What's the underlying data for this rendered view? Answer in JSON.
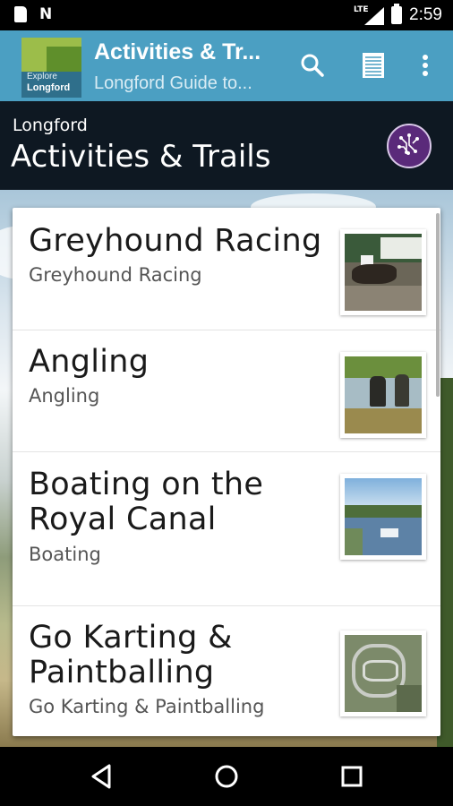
{
  "status_bar": {
    "network_label": "LTE",
    "time": "2:59",
    "icons": [
      "sd-card-icon",
      "n-notification-icon",
      "signal-icon",
      "battery-icon"
    ]
  },
  "app_bar": {
    "logo_line1": "Explore",
    "logo_line2": "Longford",
    "title": "Activities & Tr...",
    "subtitle": "Longford Guide to...",
    "icons": [
      "search-icon",
      "list-view-icon",
      "more-vert-icon"
    ],
    "background_color": "#4b9fc2"
  },
  "page_header": {
    "subtitle": "Longford",
    "title": "Activities & Trails",
    "badge_icon": "circuit-icon",
    "badge_color": "#5a2a7a"
  },
  "items": [
    {
      "title": "Greyhound Racing",
      "subtitle": "Greyhound Racing",
      "thumb_icon": "greyhound-photo"
    },
    {
      "title": "Angling",
      "subtitle": "Angling",
      "thumb_icon": "angling-photo"
    },
    {
      "title": "Boating on the Royal Canal",
      "subtitle": "Boating",
      "thumb_icon": "boating-photo"
    },
    {
      "title": "Go Karting & Paintballing",
      "subtitle": "Go Karting & Paintballing",
      "thumb_icon": "karting-photo"
    }
  ],
  "nav_bar": {
    "icons": [
      "back-icon",
      "home-icon",
      "recents-icon"
    ]
  }
}
